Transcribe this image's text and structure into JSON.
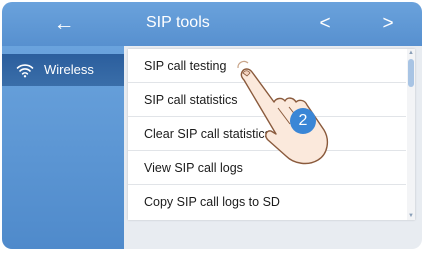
{
  "header": {
    "back_icon": "arrow-left-icon",
    "title": "SIP tools",
    "prev_icon": "chevron-left-icon",
    "next_icon": "chevron-right-icon",
    "color": "#5b95d3"
  },
  "sidebar": {
    "items": [
      {
        "label": "Wireless",
        "icon": "wifi-icon",
        "selected": true
      }
    ],
    "selected_color": "#2f639f"
  },
  "list": {
    "items": [
      {
        "label": "SIP call testing"
      },
      {
        "label": "SIP call statistics"
      },
      {
        "label": "Clear SIP call statistics"
      },
      {
        "label": "View SIP call logs"
      },
      {
        "label": "Copy SIP call logs to SD"
      }
    ]
  },
  "overlay": {
    "hand_icon": "pointing-hand-icon",
    "step_number": "2",
    "badge_color": "#3a86d6"
  }
}
